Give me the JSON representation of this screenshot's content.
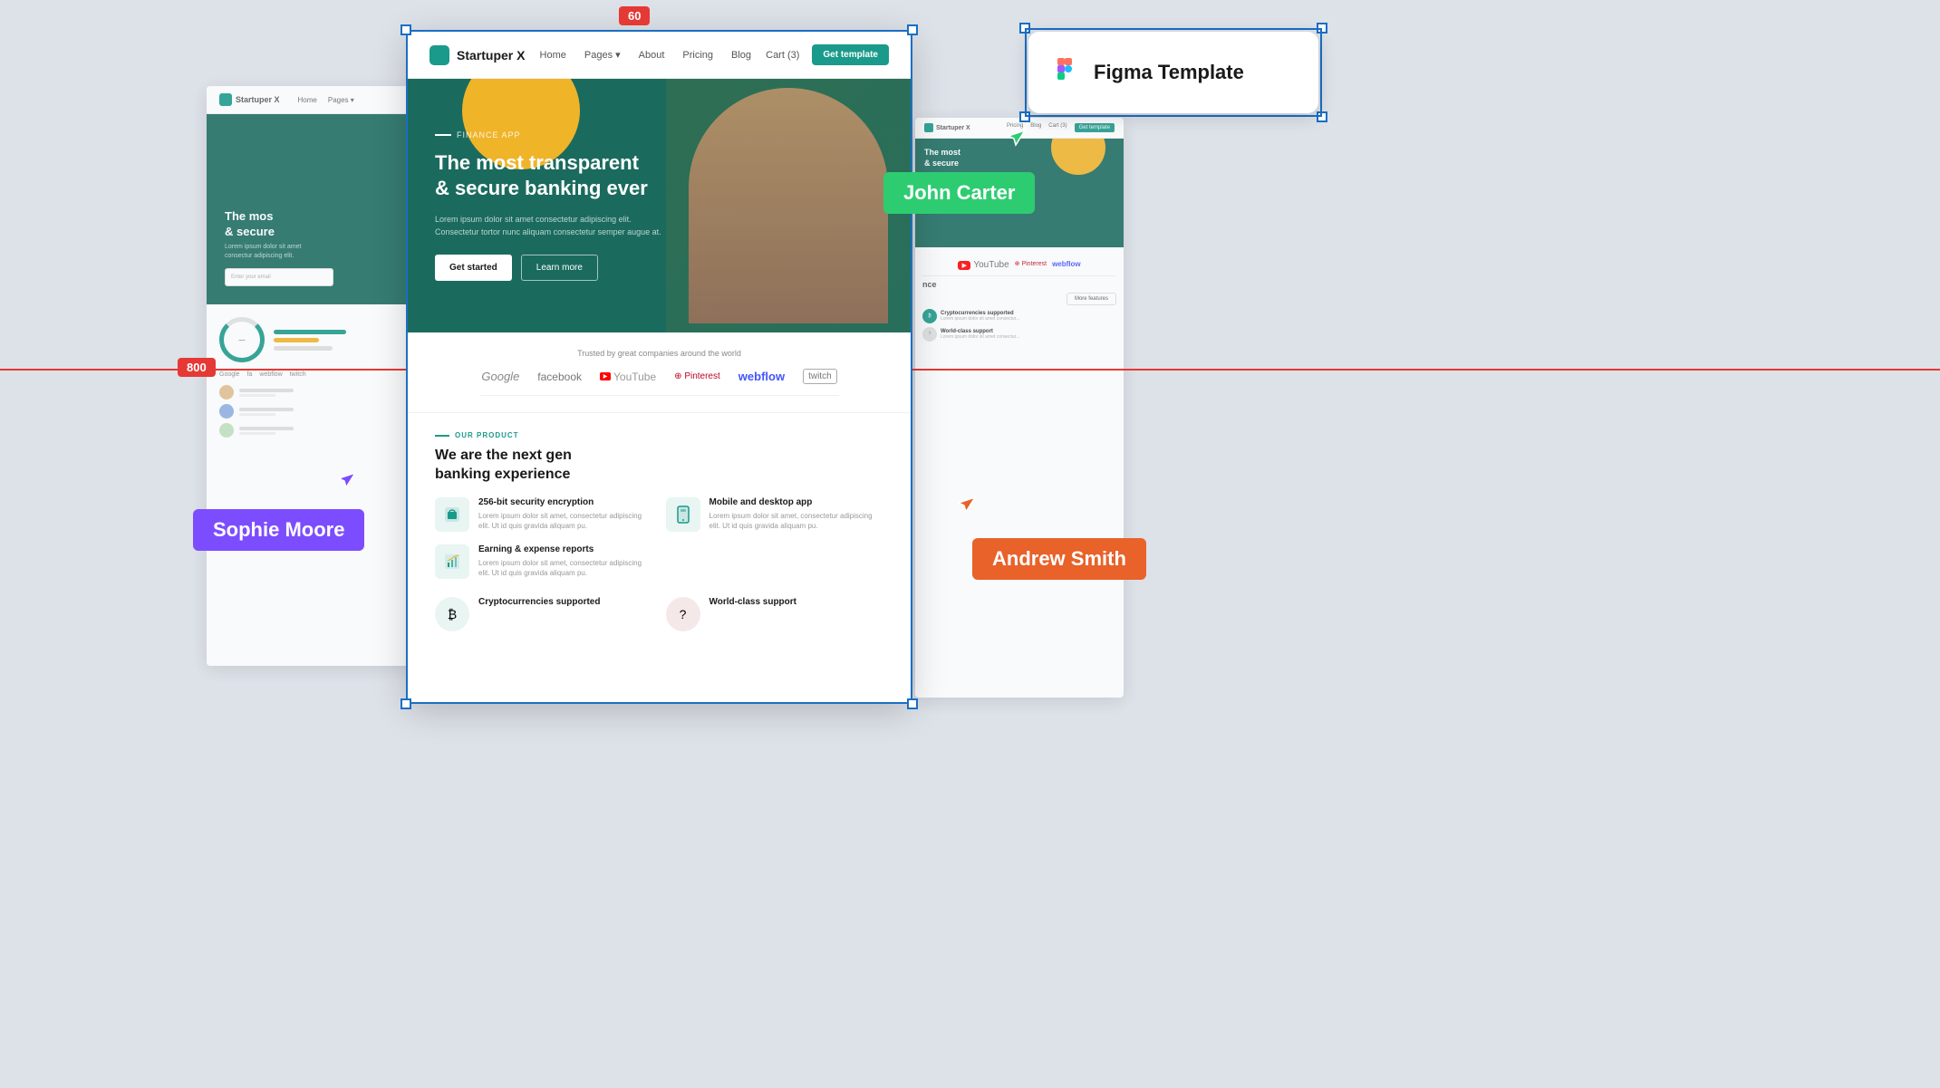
{
  "canvas": {
    "background": "#dde1e8"
  },
  "measure_labels": {
    "label_60": "60",
    "label_800": "800"
  },
  "name_badges": {
    "john_carter": "John Carter",
    "sophie_moore": "Sophie Moore",
    "andrew_smith": "Andrew Smith"
  },
  "figma_template": {
    "title": "Figma Template"
  },
  "website": {
    "brand": "Startuper X",
    "nav_links": [
      "Home",
      "Pages",
      "About",
      "Pricing",
      "Blog"
    ],
    "cart": "Cart (3)",
    "cta_button": "Get template",
    "hero": {
      "tag": "FINANCE APP",
      "title_line1": "The most transparent",
      "title_line2": "& secure banking ever",
      "subtitle": "Lorem ipsum dolor sit amet consectetur adipiscing elit. Consectetur tortor nunc aliquam consectetur semper augue at.",
      "btn_primary": "Get started",
      "btn_secondary": "Learn more"
    },
    "trusted": {
      "heading": "Trusted by great companies around the world",
      "logos": [
        "Google",
        "facebook",
        "YouTube",
        "Pinterest",
        "webflow",
        "twitch"
      ]
    },
    "product_section": {
      "tag": "OUR PRODUCT",
      "title_line1": "We are the next gen",
      "title_line2": "banking experience",
      "features": [
        {
          "title": "256-bit security encryption",
          "desc": "Lorem ipsum dolor sit amet, consectetur adipiscing elit. Ut id quis gravida aliquam pu."
        },
        {
          "title": "Mobile and desktop app",
          "desc": "Lorem ipsum dolor sit amet, consectetur adipiscing elit. Ut id quis gravida aliquam pu."
        },
        {
          "title": "Earning & expense reports",
          "desc": "Lorem ipsum dolor sit amet, consectetur adipiscing elit. Ut id quis gravida aliquam pu."
        }
      ],
      "bottom_features": [
        {
          "title": "Cryptocurrencies supported",
          "desc": ""
        },
        {
          "title": "World-class support",
          "desc": ""
        }
      ]
    }
  },
  "bg_right_website": {
    "nav_links": [
      "Pricing",
      "Blog"
    ],
    "cart": "Cart (3)",
    "cta": "Get template",
    "hero_title_line1": "The most",
    "hero_title_line2": "& secure",
    "logos": [
      "YouTube",
      "Pinterest",
      "webflow"
    ],
    "section_label": "nce",
    "more_features": "More features",
    "feature_title": "Cryptocurrencies supported",
    "support_title": "World-class support"
  }
}
